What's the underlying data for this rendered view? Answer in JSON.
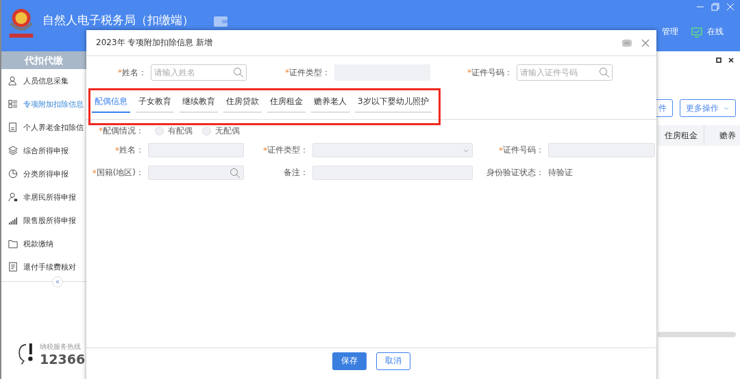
{
  "app": {
    "title": "自然人电子税务局（扣缴端）",
    "header_links": [
      {
        "label": "管理"
      },
      {
        "label": "在线"
      }
    ],
    "sidebar": {
      "title": "代扣代缴",
      "items": [
        {
          "label": "人员信息采集",
          "selected": false
        },
        {
          "label": "专项附加扣除信息",
          "selected": true
        },
        {
          "label": "个人养老金扣除信",
          "selected": false
        },
        {
          "label": "综合所得申报",
          "selected": false
        },
        {
          "label": "分类所得申报",
          "selected": false
        },
        {
          "label": "非居民所得申报",
          "selected": false
        },
        {
          "label": "限售股所得申报",
          "selected": false
        },
        {
          "label": "税款缴纳",
          "selected": false
        },
        {
          "label": "退付手续费核对",
          "selected": false
        }
      ],
      "collapse": "«",
      "hotline_label": "纳税服务热线",
      "hotline_number": "12366"
    },
    "toolbar": [
      {
        "label": "件"
      },
      {
        "label": "更多操作"
      }
    ],
    "table": {
      "columns": [
        "住房租金",
        "赡养"
      ]
    }
  },
  "dialog": {
    "title": "2023年 专项附加扣除信息 新增",
    "search_fields": [
      {
        "required_mark": "*",
        "label": "姓名：",
        "kind": "search",
        "placeholder": "请输入姓名"
      },
      {
        "required_mark": "*",
        "label": "证件类型：",
        "kind": "plain"
      },
      {
        "required_mark": "*",
        "label": "证件号码：",
        "kind": "search",
        "placeholder": "请输入证件号码"
      }
    ],
    "tabs": [
      {
        "label": "配偶信息",
        "selected": true
      },
      {
        "label": "子女教育",
        "selected": false
      },
      {
        "label": "继续教育",
        "selected": false
      },
      {
        "label": "住房贷款",
        "selected": false
      },
      {
        "label": "住房租金",
        "selected": false
      },
      {
        "label": "赡养老人",
        "selected": false
      },
      {
        "label": "3岁以下婴幼儿照护",
        "selected": false
      }
    ],
    "spouse_status": {
      "required_mark": "*",
      "label": "配偶情况：",
      "options": [
        {
          "label": "有配偶",
          "checked": false
        },
        {
          "label": "无配偶",
          "checked": false
        }
      ]
    },
    "form": [
      {
        "required_mark": "*",
        "label": "姓名：",
        "kind": "text"
      },
      {
        "required_mark": "*",
        "label": "证件类型：",
        "kind": "select"
      },
      {
        "required_mark": "*",
        "label": "证件号码：",
        "kind": "text"
      },
      {
        "required_mark": "*",
        "label": "国籍(地区)：",
        "kind": "search"
      },
      {
        "label": "备注：",
        "kind": "text"
      },
      {
        "label": "身份验证状态：",
        "kind": "status",
        "value": "待验证"
      }
    ],
    "buttons": [
      {
        "label": "保存",
        "kind": "primary"
      },
      {
        "label": "取消",
        "kind": "secondary"
      }
    ]
  }
}
